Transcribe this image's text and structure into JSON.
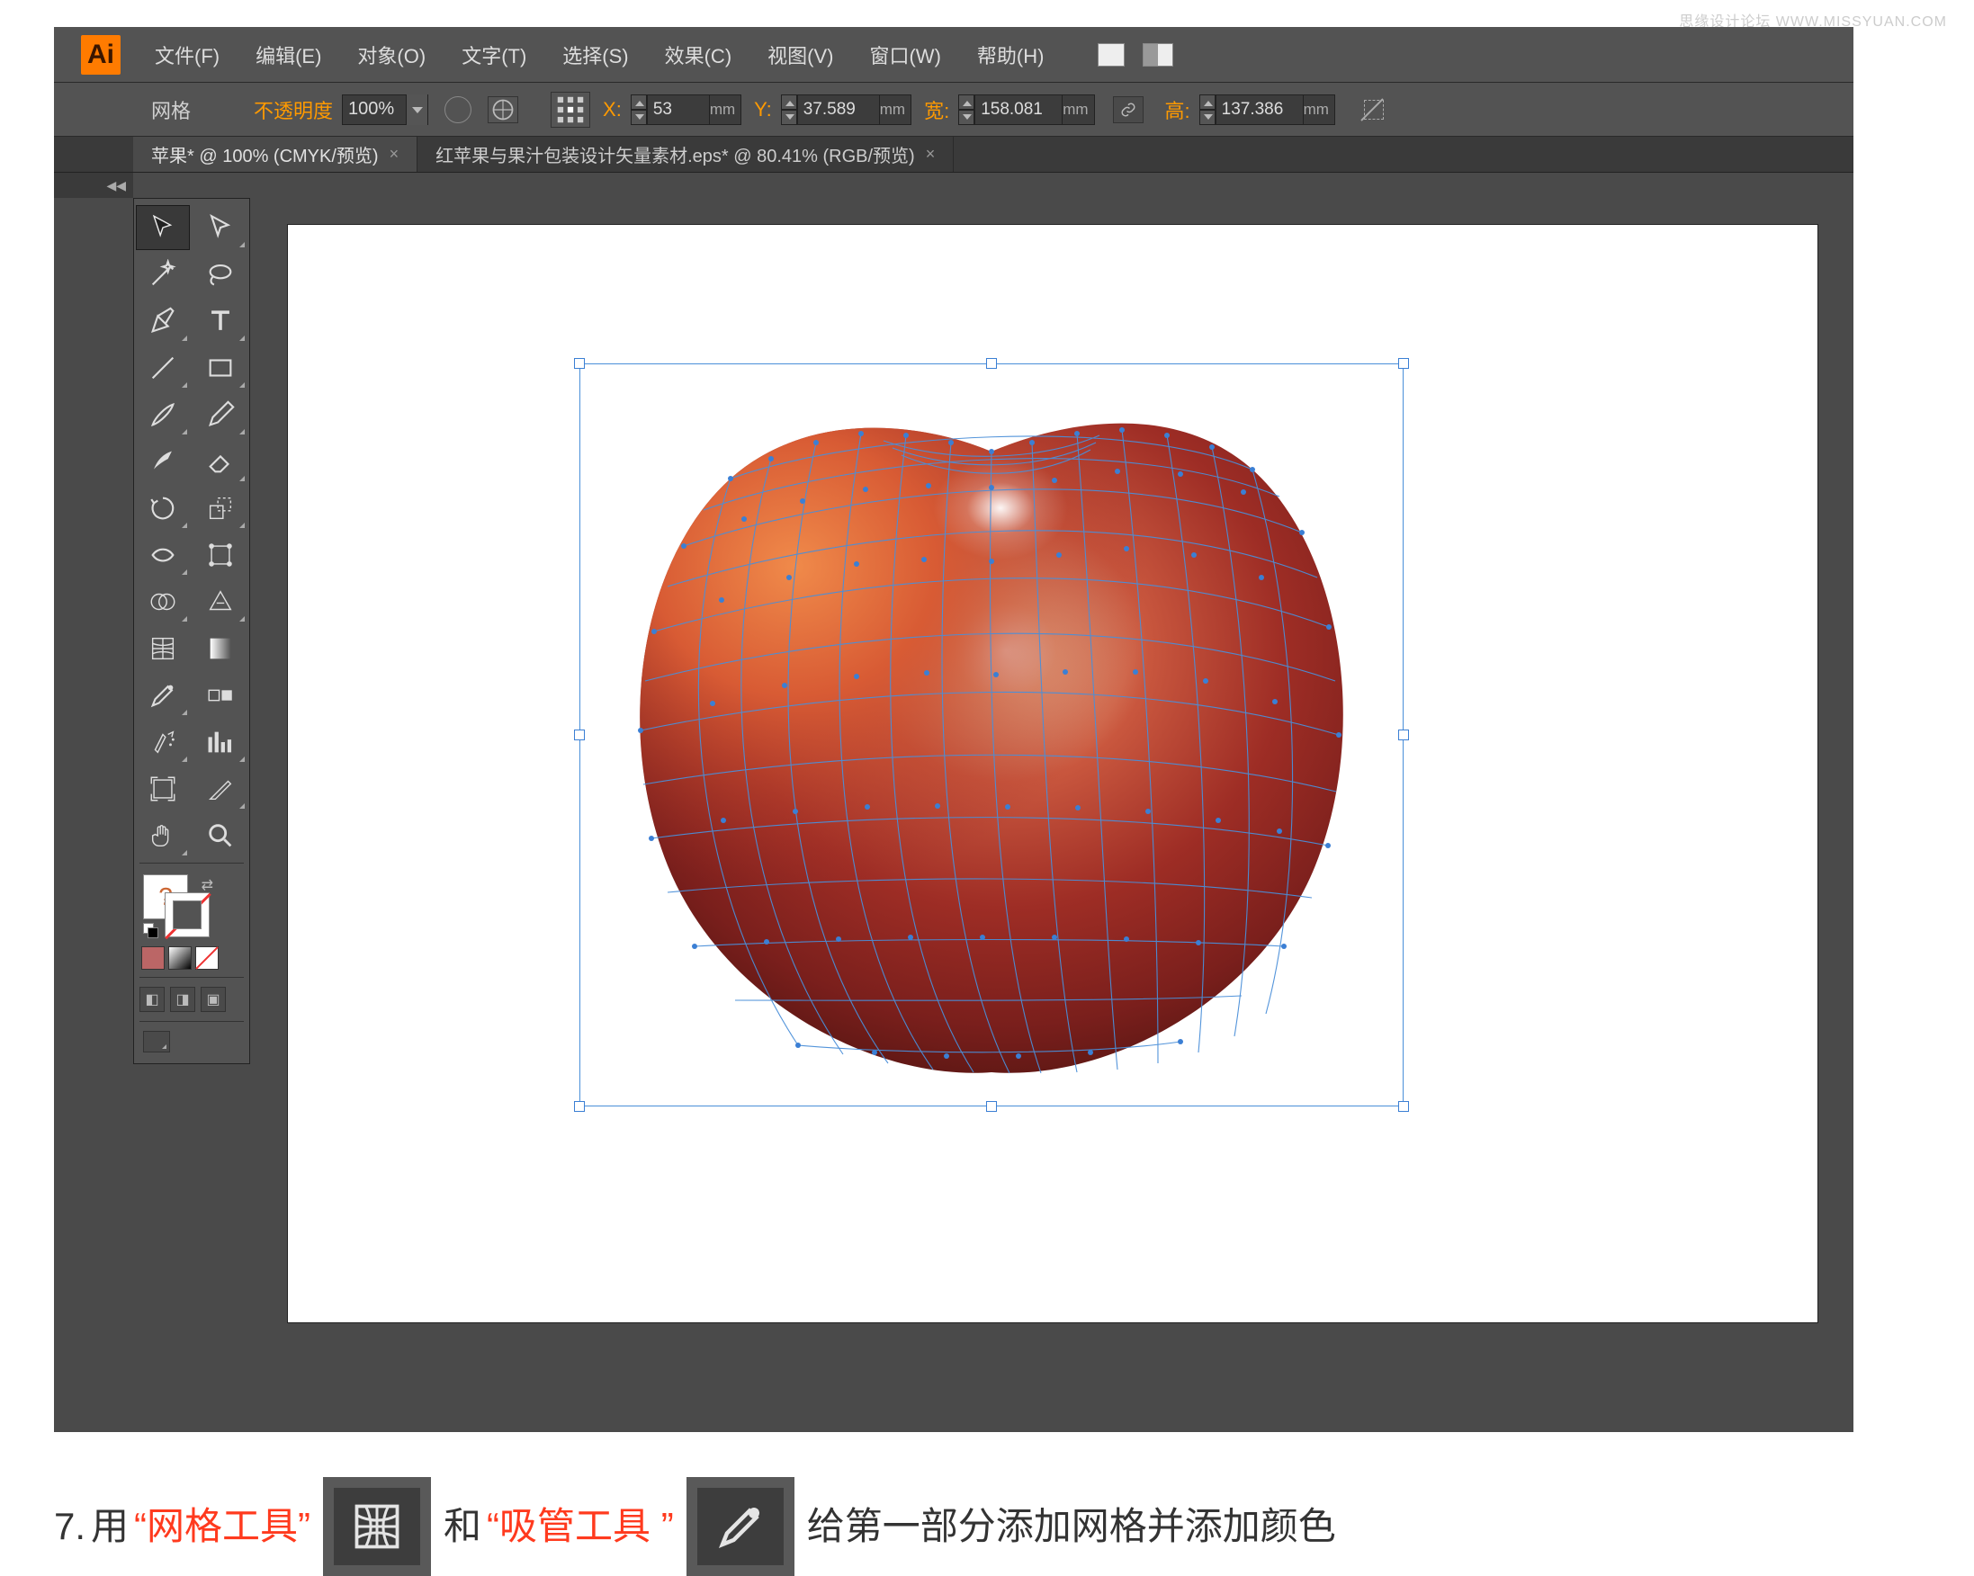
{
  "watermark": "思缘设计论坛 WWW.MISSYUAN.COM",
  "app_logo": "Ai",
  "menu": {
    "file": "文件(F)",
    "edit": "编辑(E)",
    "object": "对象(O)",
    "type": "文字(T)",
    "select": "选择(S)",
    "effect": "效果(C)",
    "view": "视图(V)",
    "window": "窗口(W)",
    "help": "帮助(H)"
  },
  "controlbar": {
    "tool_name": "网格",
    "opacity_label": "不透明度",
    "opacity_value": "100%",
    "x_label": "X:",
    "x_value": "53",
    "x_unit": "mm",
    "y_label": "Y:",
    "y_value": "37.589",
    "y_unit": "mm",
    "w_label": "宽:",
    "w_value": "158.081",
    "w_unit": "mm",
    "h_label": "高:",
    "h_value": "137.386",
    "h_unit": "mm"
  },
  "tabs": {
    "active": "苹果* @ 100% (CMYK/预览)",
    "inactive": "红苹果与果汁包装设计矢量素材.eps* @ 80.41% (RGB/预览)"
  },
  "instruction": {
    "step": "7.",
    "t1": "用",
    "q1": "“网格工具”",
    "t2": "和",
    "q2": "“吸管工具 ”",
    "t3": "给第一部分添加网格并添加颜色"
  },
  "chart_data": {
    "type": "screenshot",
    "note": "Adobe Illustrator mesh tool editing an apple shape; not a data chart."
  }
}
